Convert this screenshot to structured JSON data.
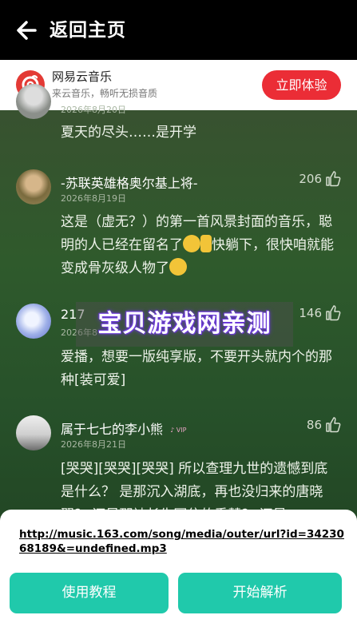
{
  "header": {
    "title": "返回主页"
  },
  "banner": {
    "app_name": "网易云音乐",
    "tagline": "来云音乐，畅听无损音质",
    "cta": "立即体验"
  },
  "comments": [
    {
      "user": "",
      "date": "2026年8月20日",
      "likes": "",
      "text": "夏天的尽头……是开学"
    },
    {
      "user": "-苏联英雄格奥尔基上将-",
      "date": "2026年8月19日",
      "likes": "206",
      "text1": "这是（虚无？）的第一首风景封面的音乐，聪明的人已经在留名了",
      "text2": "快躺下，很快咱就能变成骨灰级人物了"
    },
    {
      "user": "217",
      "date": "2026年8",
      "likes": "146",
      "text": "爱播，想要一版纯享版，不要开头就内个的那种[装可爱]"
    },
    {
      "user": "属于七七的李小熊",
      "date": "2026年8月21日",
      "likes": "86",
      "text": "[哭哭][哭哭][哭哭] 所以查理九世的遗憾到底是什么？ 是那沉入湖底，再也没归来的唐晓翼？ 还是那被长生困住的乖慧？ 还是"
    }
  ],
  "watermark": "宝贝游戏网亲测",
  "sheet": {
    "url": "http://music.163.com/song/media/outer/url?id=3423068189&=undefined.mp3",
    "tutorial_label": "使用教程",
    "parse_label": "开始解析"
  }
}
